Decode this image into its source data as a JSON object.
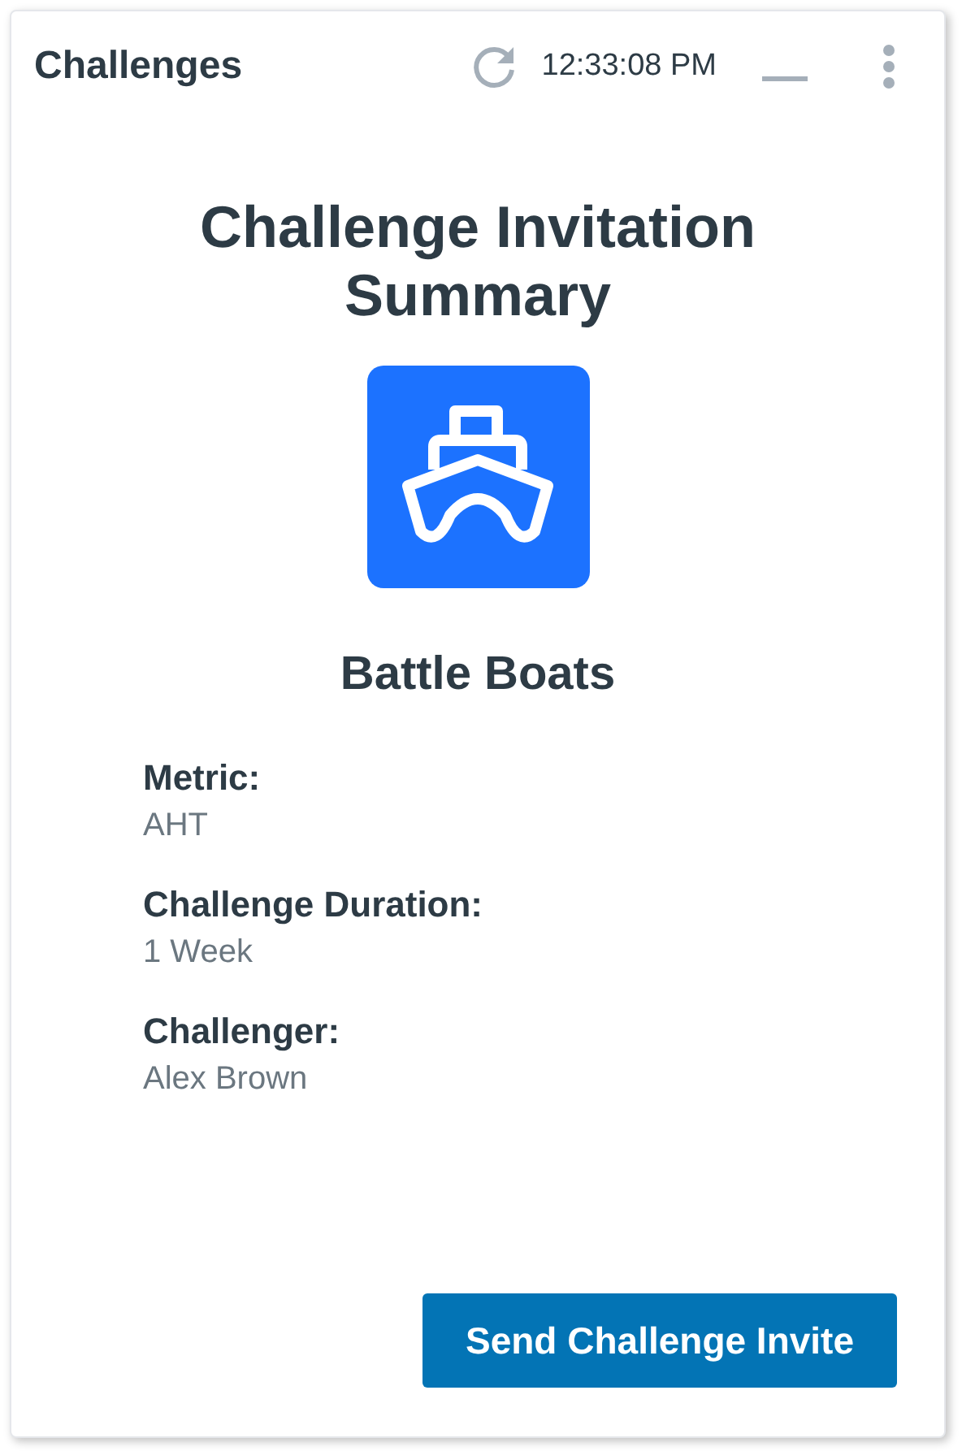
{
  "header": {
    "title": "Challenges",
    "time": "12:33:08 PM"
  },
  "summary": {
    "title": "Challenge Invitation Summary",
    "game": "Battle Boats",
    "fields": [
      {
        "label": "Metric:",
        "value": "AHT"
      },
      {
        "label": "Challenge Duration:",
        "value": "1 Week"
      },
      {
        "label": "Challenger:",
        "value": "Alex Brown"
      }
    ]
  },
  "button": "Send Challenge Invite"
}
